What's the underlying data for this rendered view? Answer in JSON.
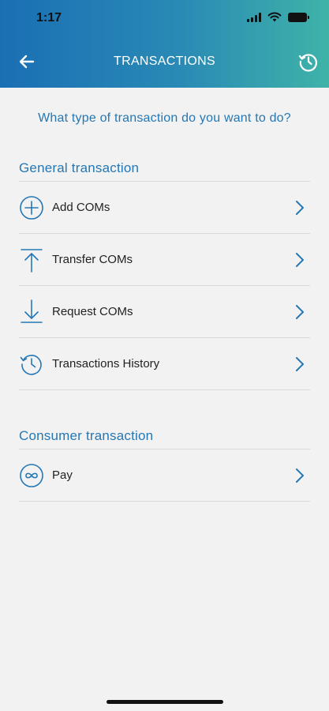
{
  "status_bar": {
    "time": "1:17"
  },
  "nav": {
    "title": "TRANSACTIONS"
  },
  "question": "What type of transaction do you want to do?",
  "sections": [
    {
      "title": "General transaction",
      "items": [
        {
          "label": "Add COMs",
          "icon": "plus-circle-icon"
        },
        {
          "label": "Transfer COMs",
          "icon": "upload-arrow-icon"
        },
        {
          "label": "Request COMs",
          "icon": "download-arrow-icon"
        },
        {
          "label": "Transactions History",
          "icon": "history-icon"
        }
      ]
    },
    {
      "title": "Consumer transaction",
      "items": [
        {
          "label": "Pay",
          "icon": "infinity-circle-icon"
        }
      ]
    }
  ],
  "colors": {
    "accent": "#2577b4",
    "header_start": "#1a6fb4",
    "header_end": "#3fb3a8"
  }
}
